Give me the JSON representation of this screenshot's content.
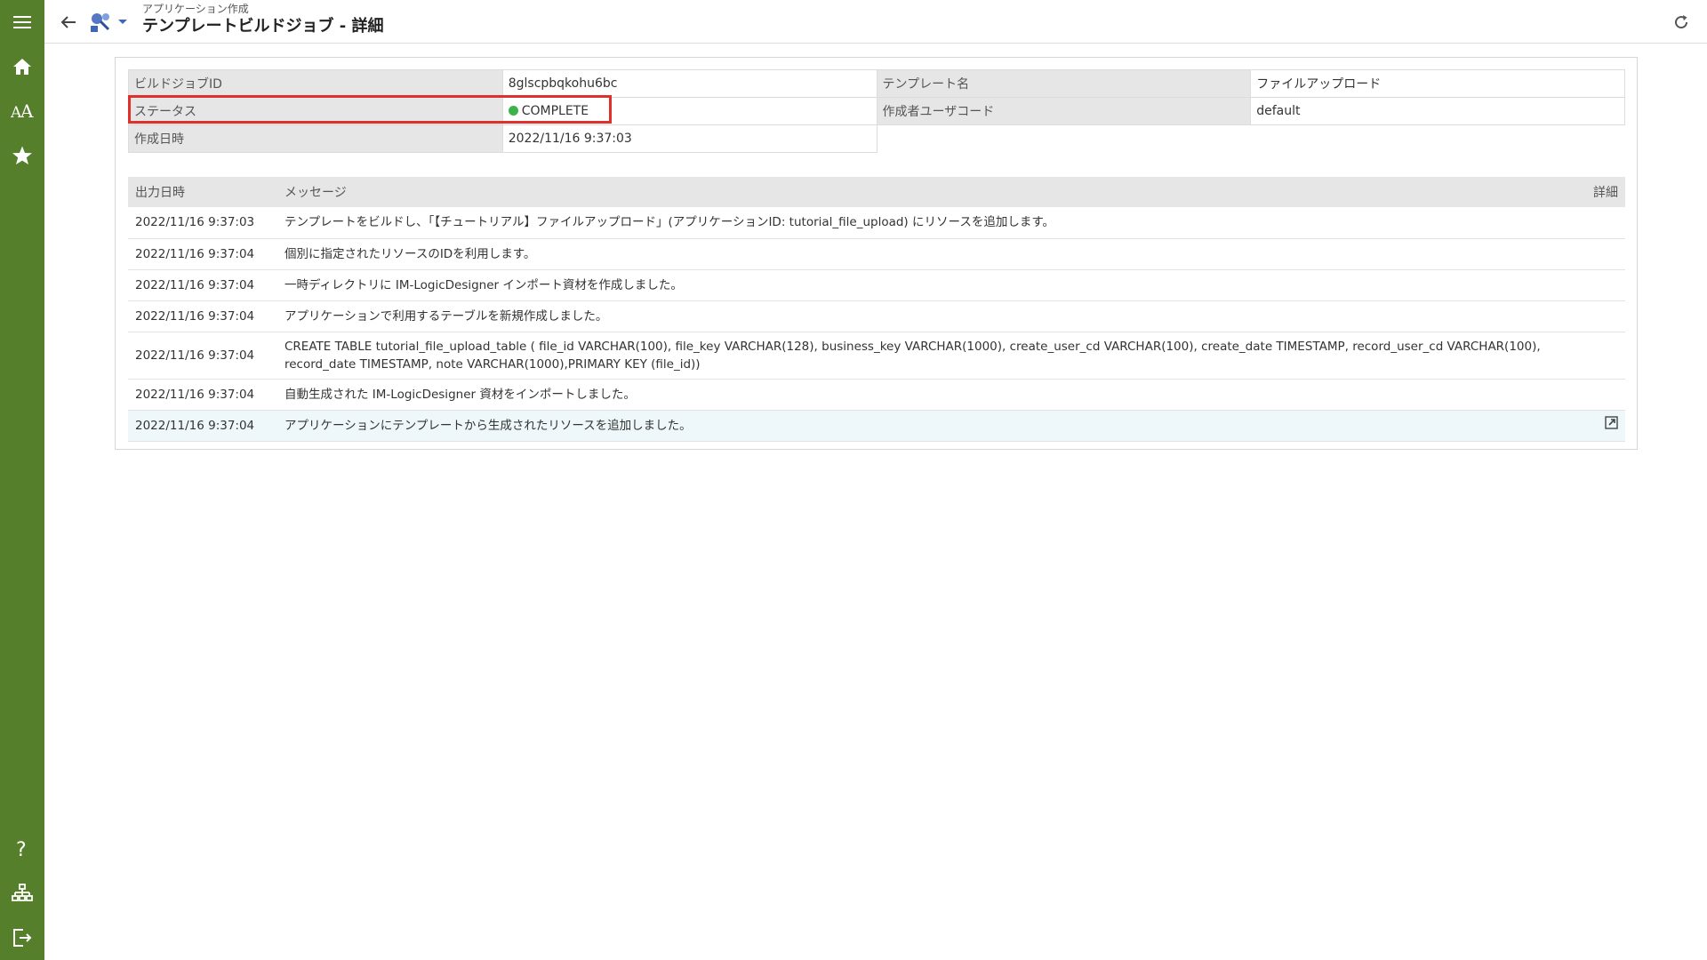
{
  "sidebar": {
    "top_items": [
      {
        "name": "menu-icon"
      },
      {
        "name": "home-icon"
      },
      {
        "name": "font-aa-icon"
      },
      {
        "name": "star-icon"
      }
    ],
    "bottom_items": [
      {
        "name": "help-icon"
      },
      {
        "name": "sitemap-icon"
      },
      {
        "name": "logout-icon"
      }
    ],
    "background": "#567f2b"
  },
  "header": {
    "subtitle": "アプリケーション作成",
    "title": "テンプレートビルドジョブ - 詳細"
  },
  "info": {
    "build_job_id_label": "ビルドジョブID",
    "build_job_id_value": "8glscpbqkohu6bc",
    "template_name_label": "テンプレート名",
    "template_name_value": "ファイルアップロード",
    "status_label": "ステータス",
    "status_value": "COMPLETE",
    "status_color": "#3bb24a",
    "creator_label": "作成者ユーザコード",
    "creator_value": "default",
    "created_at_label": "作成日時",
    "created_at_value": "2022/11/16 9:37:03"
  },
  "highlight_color": "#e0302c",
  "log": {
    "headers": {
      "time": "出力日時",
      "message": "メッセージ",
      "detail": "詳細"
    },
    "rows": [
      {
        "time": "2022/11/16 9:37:03",
        "message": "テンプレートをビルドし、「【チュートリアル】ファイルアップロード」(アプリケーションID: tutorial_file_upload) にリソースを追加します。"
      },
      {
        "time": "2022/11/16 9:37:04",
        "message": "個別に指定されたリソースのIDを利用します。"
      },
      {
        "time": "2022/11/16 9:37:04",
        "message": "一時ディレクトリに IM-LogicDesigner インポート資材を作成しました。"
      },
      {
        "time": "2022/11/16 9:37:04",
        "message": "アプリケーションで利用するテーブルを新規作成しました。"
      },
      {
        "time": "2022/11/16 9:37:04",
        "message": "CREATE TABLE tutorial_file_upload_table ( file_id VARCHAR(100), file_key VARCHAR(128), business_key VARCHAR(1000), create_user_cd VARCHAR(100), create_date TIMESTAMP, record_user_cd VARCHAR(100), record_date TIMESTAMP, note VARCHAR(1000),PRIMARY KEY (file_id))"
      },
      {
        "time": "2022/11/16 9:37:04",
        "message": "自動生成された IM-LogicDesigner 資材をインポートしました。"
      },
      {
        "time": "2022/11/16 9:37:04",
        "message": "アプリケーションにテンプレートから生成されたリソースを追加しました。",
        "has_detail": true
      }
    ]
  }
}
